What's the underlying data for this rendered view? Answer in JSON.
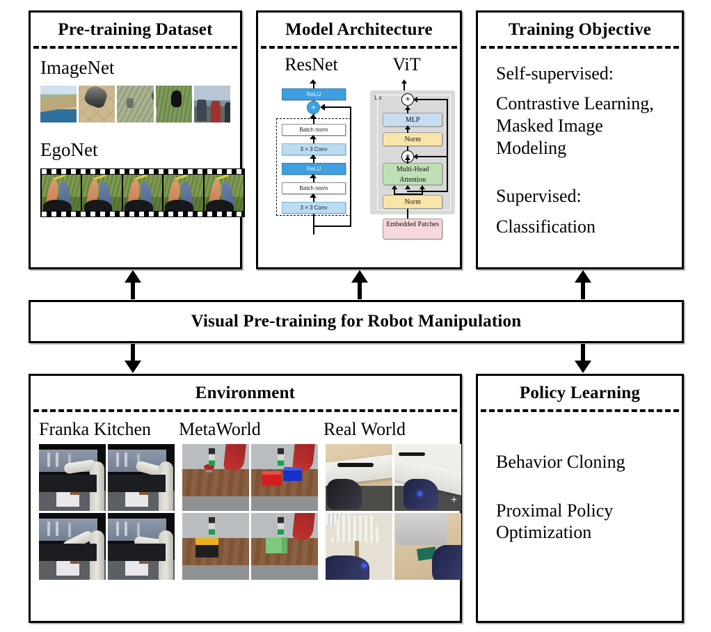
{
  "figure": {
    "center_banner": "Visual Pre-training for Robot Manipulation"
  },
  "panels": {
    "pretraining_dataset": {
      "title": "Pre-training Dataset",
      "datasets": [
        {
          "name": "ImageNet",
          "media": "image-thumbnail-strip",
          "thumbnails": [
            "coastal-landscape",
            "dog-on-tiled-floor",
            "goats-in-field",
            "dogs-on-grass",
            "fishermen-with-catch"
          ]
        },
        {
          "name": "EgoNet",
          "media": "film-strip",
          "frames": [
            "egocentric-hands-grass-1",
            "egocentric-hands-grass-2",
            "egocentric-hands-grass-3",
            "egocentric-hands-grass-4",
            "egocentric-hands-grass-5"
          ]
        }
      ]
    },
    "model_architecture": {
      "title": "Model Architecture",
      "models": [
        {
          "name": "ResNet",
          "blocks": [
            "ReLU",
            "Batch norm",
            "3 × 3 Conv",
            "ReLU",
            "Batch norm",
            "3 × 3 Conv"
          ],
          "operator": "+",
          "skip_connection": "identity-shortcut",
          "colors": {
            "activation": "#3f9fe0",
            "conv": "#bcdcf2",
            "norm": "#ffffff"
          }
        },
        {
          "name": "ViT",
          "repeat_label": "L x",
          "blocks": [
            "MLP",
            "Norm",
            "Multi-Head Attention",
            "Norm",
            "Embedded Patches"
          ],
          "operator": "+",
          "colors": {
            "mlp": "#c6dcf0",
            "norm": "#fae5a8",
            "attention": "#bfe0b4",
            "embedded": "#f6d7dc",
            "box": "#d9d9d9"
          }
        }
      ]
    },
    "training_objective": {
      "title": "Training Objective",
      "groups": [
        {
          "heading": "Self-supervised:",
          "items": [
            "Contrastive Learning,",
            "Masked Image",
            "Modeling"
          ]
        },
        {
          "heading": "Supervised:",
          "items": [
            "Classification"
          ]
        }
      ]
    },
    "environment": {
      "title": "Environment",
      "columns": [
        {
          "name": "Franka Kitchen",
          "thumbnails": [
            "franka-kitchen-1",
            "franka-kitchen-2",
            "franka-kitchen-3",
            "franka-kitchen-4"
          ]
        },
        {
          "name": "MetaWorld",
          "thumbnails": [
            "metaworld-button-press",
            "metaworld-bin-picking",
            "metaworld-hammer",
            "metaworld-drawer-open"
          ]
        },
        {
          "name": "Real World",
          "thumbnails": [
            "real-world-drawer-open",
            "real-world-cabinet-open",
            "real-world-lamp-reach",
            "real-world-sponge-pick"
          ]
        }
      ]
    },
    "policy_learning": {
      "title": "Policy Learning",
      "methods": [
        "Behavior Cloning",
        "Proximal Policy",
        "Optimization"
      ]
    }
  },
  "arrows": {
    "up_to_dataset": "arrow-up",
    "up_to_architecture": "arrow-up",
    "up_to_objective": "arrow-up",
    "down_to_environment": "arrow-down",
    "down_to_policy": "arrow-down"
  }
}
